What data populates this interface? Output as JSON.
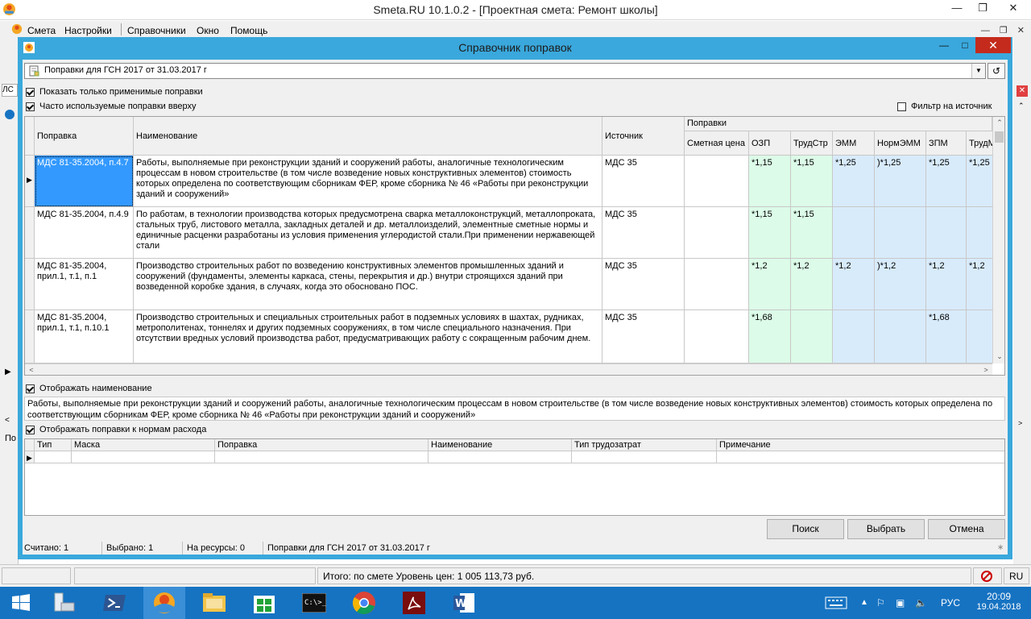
{
  "app": {
    "title": "Smeta.RU  10.1.0.2  - [Проектная смета: Ремонт школы]",
    "menu": [
      "Смета",
      "Настройки",
      "Справочники",
      "Окно",
      "Помощь"
    ],
    "status": {
      "total": "Итого: по смете Уровень цен: 1 005 113,73 руб.",
      "lang": "RU"
    },
    "left_labels": [
      "ЛС",
      "По"
    ]
  },
  "dialog": {
    "title": "Справочник поправок",
    "combo_value": "Поправки  для ГСН 2017 от 31.03.2017 г",
    "chk_only_applicable": "Показать только применимые поправки",
    "chk_frequent_top": "Часто используемые поправки вверху",
    "chk_source_filter": "Фильтр на источник",
    "columns": {
      "amendment": "Поправка",
      "name": "Наименование",
      "source": "Источник",
      "group": "Поправки",
      "estimate_price": "Сметная цена",
      "ozp": "ОЗП",
      "trudstr": "ТрудСтр",
      "emm": "ЭММ",
      "normemm": "НормЭММ",
      "zpm": "ЗПМ",
      "trudm": "ТрудМ"
    },
    "rows": [
      {
        "amendment": "МДС 81-35.2004, п.4.7",
        "name": "Работы, выполняемые при реконструкции зданий и сооружений работы, аналогичные технологическим процессам в новом строительстве (в том числе возведение новых конструктивных элементов) стоимость которых определена по соответствующим сборникам ФЕР, кроме сборника № 46 «Работы при реконструкции зданий и сооружений»",
        "source": "МДС 35",
        "ozp": "*1,15",
        "trudstr": "*1,15",
        "emm": "*1,25",
        "normemm": ")*1,25",
        "zpm": "*1,25",
        "trudm": "*1,25"
      },
      {
        "amendment": "МДС 81-35.2004, п.4.9",
        "name": "По работам, в технологии производства которых предусмотрена сварка металлоконструкций, металлопроката, стальных труб, листового металла, закладных деталей и др. металлоизделий, элементные сметные нормы и единичные расценки разработаны из условия применения углеродистой стали.При применении нержавеющей стали",
        "source": "МДС 35",
        "ozp": "*1,15",
        "trudstr": "*1,15",
        "emm": "",
        "normemm": "",
        "zpm": "",
        "trudm": ""
      },
      {
        "amendment": "МДС 81-35.2004, прил.1, т.1, п.1",
        "name": "Производство строительных работ по возведению конструктивных элементов промышленных зданий и сооружений (фундаменты, элементы каркаса, стены, перекрытия и др.) внутри строящихся зданий при возведенной коробке здания, в случаях, когда это обосновано ПОС.",
        "source": "МДС 35",
        "ozp": "*1,2",
        "trudstr": "*1,2",
        "emm": "*1,2",
        "normemm": ")*1,2",
        "zpm": "*1,2",
        "trudm": "*1,2"
      },
      {
        "amendment": "МДС 81-35.2004, прил.1, т.1, п.10.1",
        "name": "Производство строительных и специальных строительных работ в подземных условиях в шахтах, рудниках, метрополитенах, тоннелях и других подземных сооружениях, в том числе специального назначения. При отсутствии вредных условий производства работ, предусматривающих работу с сокращенным рабочим днем.",
        "source": "МДС 35",
        "ozp": "*1,68",
        "trudstr": "",
        "emm": "",
        "normemm": "",
        "zpm": "*1,68",
        "trudm": ""
      }
    ],
    "chk_show_name": "Отображать наименование",
    "description": "Работы, выполняемые при реконструкции зданий и сооружений работы, аналогичные технологическим процессам в новом строительстве (в том числе возведение новых конструктивных элементов) стоимость которых определена по соответствующим сборникам ФЕР, кроме сборника № 46 «Работы при реконструкции зданий и сооружений»",
    "chk_show_norms": "Отображать поправки к нормам расхода",
    "norm_columns": [
      "Тип",
      "Маска",
      "Поправка",
      "Наименование",
      "Тип трудозатрат",
      "Примечание"
    ],
    "buttons": {
      "search": "Поиск",
      "select": "Выбрать",
      "cancel": "Отмена"
    },
    "status": {
      "counted": "Считано: 1",
      "selected": "Выбрано: 1",
      "on_resources": "На ресурсы: 0",
      "catalog": "Поправки  для ГСН 2017 от 31.03.2017 г"
    }
  },
  "taskbar": {
    "lang": "РУС",
    "time": "20:09",
    "date": "19.04.2018"
  }
}
